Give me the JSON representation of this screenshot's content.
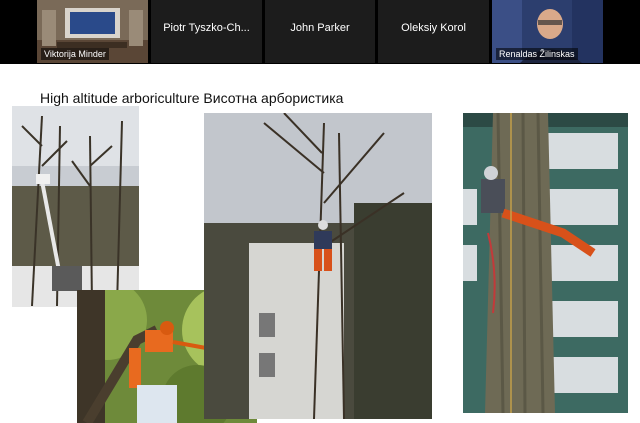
{
  "participants": [
    {
      "name": "Viktorija Minder",
      "video": true
    },
    {
      "name": "Piotr Tyszko-Ch...",
      "video": false
    },
    {
      "name": "John Parker",
      "video": false
    },
    {
      "name": "Oleksiy Korol",
      "video": false
    },
    {
      "name": "Renaldas Žilinskas",
      "video": true
    }
  ],
  "slide": {
    "title": "High altitude arboriculture Висотна арбористика"
  }
}
